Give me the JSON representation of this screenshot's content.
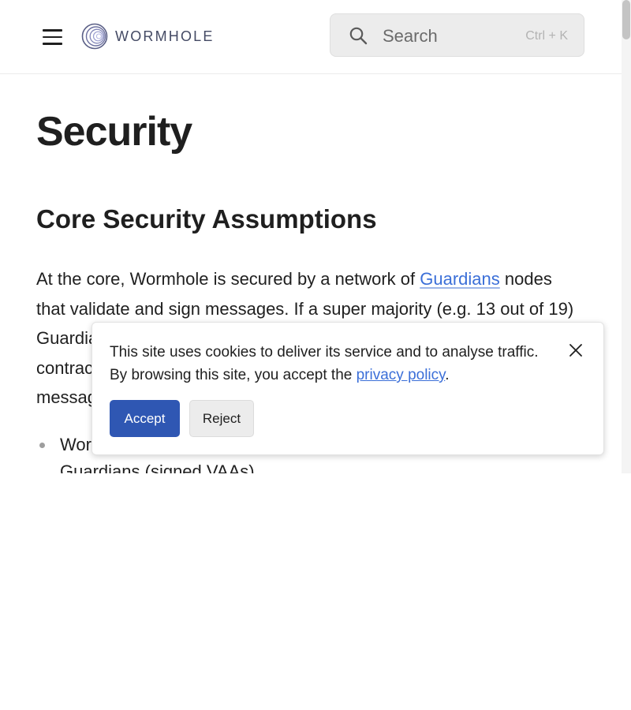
{
  "header": {
    "logo_text": "WORMHOLE",
    "search_placeholder": "Search",
    "search_shortcut": "Ctrl + K"
  },
  "content": {
    "page_title": "Security",
    "section_heading": "Core Security Assumptions",
    "paragraph": {
      "text_before_link": "At the core, Wormhole is secured by a network of ",
      "link_text": "Guardians",
      "text_after_link": " nodes that validate and sign messages. If a super majority (e.g. 13 out of 19) Guardians sign the same message, it can be considered valid. A smart contract on the target chain will verify the signatures and format of the message."
    },
    "bullets": [
      "Wormhole core contracts only process messages signed by Guardians (signed VAAs)"
    ]
  },
  "cookie_banner": {
    "text_before_link": "This site uses cookies to deliver its service and to analyse traffic. By browsing this site, you accept the ",
    "link_text": "privacy policy",
    "text_after_link": ".",
    "accept_label": "Accept",
    "reject_label": "Reject"
  },
  "icons": {
    "menu": "menu-icon",
    "logo": "wormhole-logo-icon",
    "search": "search-icon",
    "close": "close-icon"
  },
  "colors": {
    "link": "#3b6fd8",
    "accept_button": "#2f57b3",
    "logo_text": "#444a64",
    "search_bg": "#ececec"
  }
}
